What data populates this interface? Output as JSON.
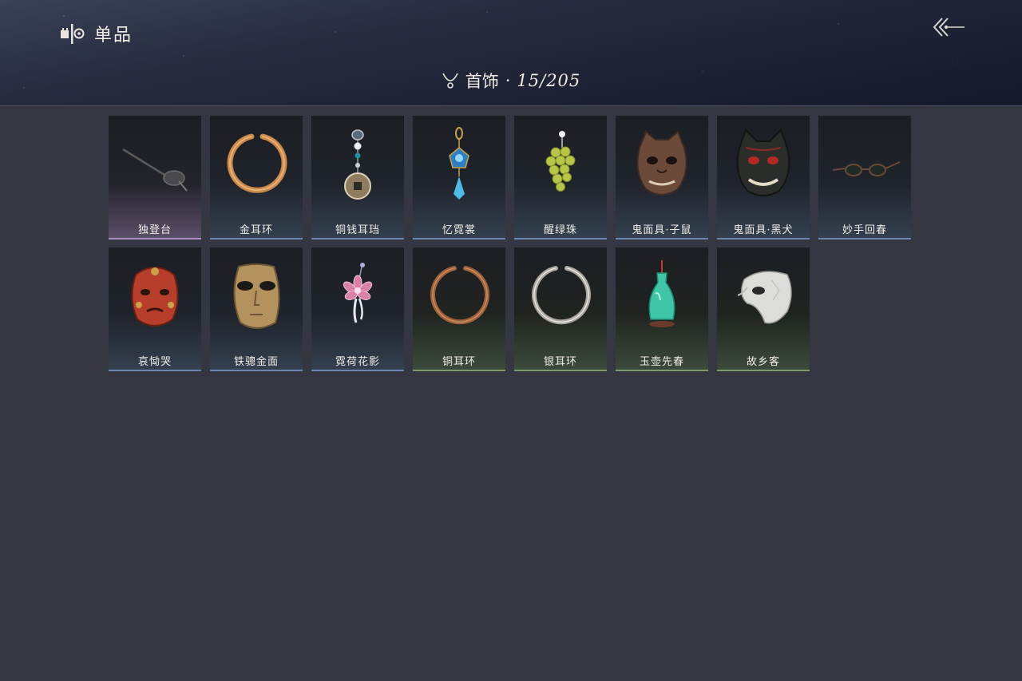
{
  "header": {
    "title": "单品"
  },
  "category": {
    "name": "首饰",
    "separator": "·",
    "count": "15/205"
  },
  "items": [
    {
      "label": "独登台",
      "rarity": "purple"
    },
    {
      "label": "金耳环",
      "rarity": "blue"
    },
    {
      "label": "铜钱耳珰",
      "rarity": "blue"
    },
    {
      "label": "忆霓裳",
      "rarity": "blue"
    },
    {
      "label": "醒绿珠",
      "rarity": "blue"
    },
    {
      "label": "鬼面具·子鼠",
      "rarity": "blue"
    },
    {
      "label": "鬼面具·黑犬",
      "rarity": "blue"
    },
    {
      "label": "妙手回春",
      "rarity": "blue"
    },
    {
      "label": "哀恸哭",
      "rarity": "blue"
    },
    {
      "label": "铁骢金面",
      "rarity": "blue"
    },
    {
      "label": "霓荷花影",
      "rarity": "blue"
    },
    {
      "label": "铜耳环",
      "rarity": "green"
    },
    {
      "label": "银耳环",
      "rarity": "green"
    },
    {
      "label": "玉壶先春",
      "rarity": "green"
    },
    {
      "label": "故乡客",
      "rarity": "green"
    }
  ],
  "colors": {
    "background": "#343741",
    "purple": "#a88fbf",
    "blue": "#6a84ad",
    "green": "#7e9a6b"
  }
}
